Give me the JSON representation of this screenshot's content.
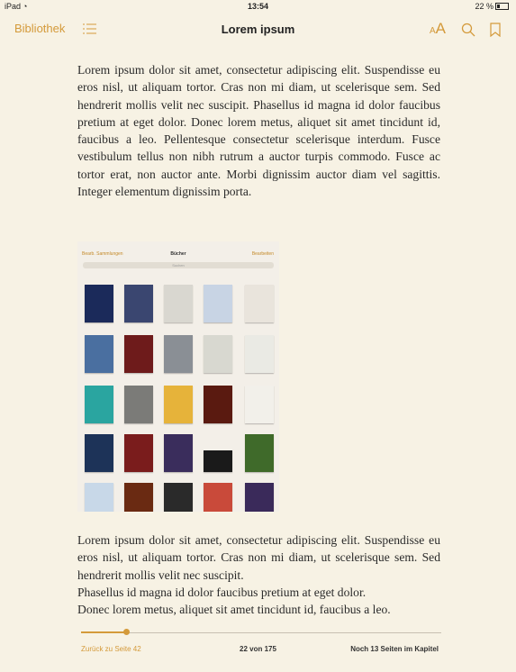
{
  "status": {
    "device": "iPad",
    "time": "13:54",
    "battery": "22 %"
  },
  "toolbar": {
    "library_label": "Bibliothek",
    "title": "Lorem ipsum",
    "aa_small": "A",
    "aa_big": "A"
  },
  "content": {
    "paragraph1": "Lorem ipsum dolor sit amet, consectetur adipiscing elit. Suspendisse eu eros nisl, ut aliquam tortor. Cras non mi diam, ut scelerisque sem. Sed hendrerit mollis velit nec suscipit. Phasellus id magna id dolor faucibus pretium at eget dolor. Donec lorem metus, aliquet sit amet tincidunt id, faucibus a leo. Pellentesque consectetur scelerisque interdum. Fusce vestibulum tellus non nibh rutrum a auctor turpis commodo. Fusce ac tortor erat, non auctor ante. Morbi dignissim auctor diam vel sagittis. Integer elementum dignissim porta.",
    "paragraph2_lines": [
      "Lorem ipsum dolor sit amet, consectetur adipiscing elit. Suspendisse eu eros nisl, ut aliquam tortor. Cras non mi diam, ut scelerisque sem. Sed hendrerit mollis velit nec suscipit.",
      "Phasellus id magna id dolor faucibus pretium at eget dolor.",
      "Donec lorem metus, aliquet sit amet tincidunt id, faucibus a leo."
    ]
  },
  "embedded_screenshot": {
    "nav_left": "Bearb.  Sammlungen",
    "nav_title": "Bücher",
    "nav_right": "Bearbeiten",
    "search_placeholder": "Suchen",
    "cover_colors": [
      [
        "#1b2a5a",
        "#3a4670",
        "#d9d7d0",
        "#c8d4e4",
        "#e9e4dc"
      ],
      [
        "#4a6fa0",
        "#6e1b1b",
        "#8a8f95",
        "#d8d8d0",
        "#eaeae4"
      ],
      [
        "#2aa5a0",
        "#7b7b78",
        "#e6b33a",
        "#5a1a10",
        "#f2f0ea"
      ],
      [
        "#1d3358",
        "#7a1c1c",
        "#3a2d5c",
        "#1a1a1a",
        "#3f6a2a"
      ],
      [
        "#c8d8e8",
        "#6a2a12",
        "#2a2a2a",
        "#c94a3a",
        "#3a2a5a"
      ]
    ]
  },
  "footer": {
    "back_label": "Zurück zu Seite 42",
    "pages": "22 von 175",
    "remaining": "Noch 13 Seiten im Kapitel"
  },
  "progress": {
    "fraction": 0.126
  },
  "colors": {
    "accent": "#d49a3a",
    "background": "#f7f2e4"
  }
}
